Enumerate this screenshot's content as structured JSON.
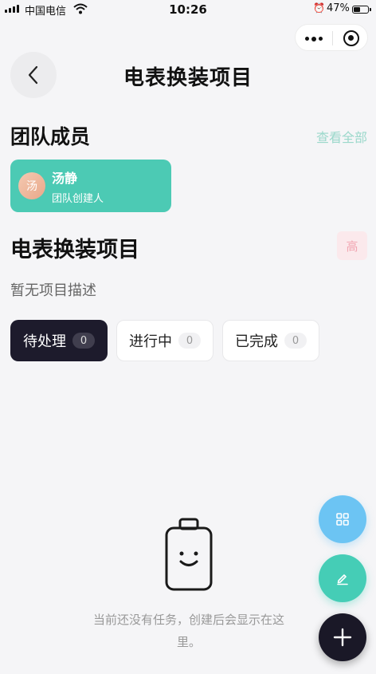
{
  "status_bar": {
    "carrier": "中国电信",
    "time": "10:26",
    "battery": "47%",
    "battery_level": 0.47
  },
  "header": {
    "title": "电表换装项目"
  },
  "team": {
    "title": "团队成员",
    "view_all": "查看全部",
    "members": [
      {
        "avatar_text": "汤",
        "name": "汤静",
        "role": "团队创建人"
      }
    ]
  },
  "project": {
    "name": "电表换装项目",
    "priority": "高",
    "description": "暂无项目描述"
  },
  "tabs": [
    {
      "label": "待处理",
      "count": "0",
      "active": true
    },
    {
      "label": "进行中",
      "count": "0",
      "active": false
    },
    {
      "label": "已完成",
      "count": "0",
      "active": false
    }
  ],
  "empty_state": {
    "line1": "当前还没有任务，创建后会显示在这",
    "line2": "里。"
  },
  "icons": {
    "back": "chevron-left-icon",
    "grid": "grid-icon",
    "edit": "edit-icon",
    "add": "plus-icon"
  },
  "colors": {
    "accent_green": "#4ccab4",
    "dark": "#1d1b2c",
    "blue": "#6cc4f3",
    "priority_bg": "#fbe9ec"
  }
}
